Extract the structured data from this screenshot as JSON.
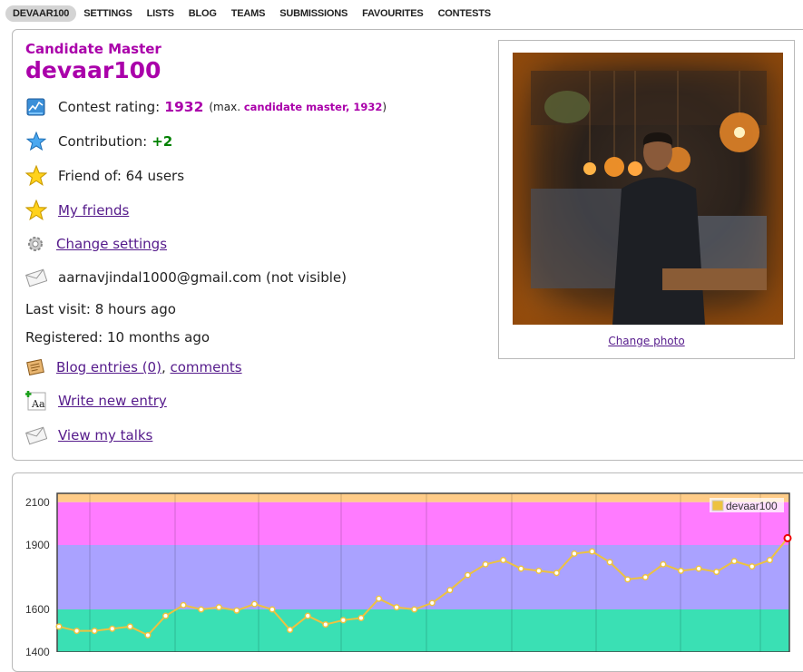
{
  "nav": {
    "items": [
      "DEVAAR100",
      "SETTINGS",
      "LISTS",
      "BLOG",
      "TEAMS",
      "SUBMISSIONS",
      "FAVOURITES",
      "CONTESTS"
    ],
    "active_index": 0
  },
  "profile": {
    "rank": "Candidate Master",
    "handle": "devaar100",
    "rating_label": "Contest rating:",
    "rating": "1932",
    "max_prefix": "(max.",
    "max_rank": "candidate master, 1932",
    "max_suffix": ")",
    "contribution_label": "Contribution:",
    "contribution": "+2",
    "friend_of": "Friend of: 64 users",
    "my_friends": "My friends",
    "change_settings": "Change settings",
    "email": "aarnavjindal1000@gmail.com (not visible)",
    "last_visit": "Last visit: 8 hours ago",
    "registered": "Registered: 10 months ago",
    "blog_entries": "Blog entries (0)",
    "comma": ",",
    "comments": "comments",
    "write_entry": "Write new entry",
    "view_talks": "View my talks",
    "change_photo": "Change photo"
  },
  "colors": {
    "rank": "#aa00aa",
    "contribution": "#008000",
    "link": "#551a8b",
    "line": "#edc240"
  },
  "chart_data": {
    "type": "line",
    "y_ticks": [
      "2100",
      "1900",
      "1600",
      "1400"
    ],
    "ylim": [
      1400,
      2130
    ],
    "legend": "top-right",
    "bands": [
      {
        "from": 1400,
        "to": 1600,
        "color": "#3ae0b4"
      },
      {
        "from": 1600,
        "to": 1900,
        "color": "#aaa2ff"
      },
      {
        "from": 1900,
        "to": 2100,
        "color": "#ff7bff"
      },
      {
        "from": 2100,
        "to": 2200,
        "color": "#ffcc88"
      }
    ],
    "series": [
      {
        "name": "devaar100",
        "values": [
          1520,
          1500,
          1500,
          1510,
          1520,
          1480,
          1570,
          1620,
          1600,
          1610,
          1595,
          1625,
          1600,
          1505,
          1570,
          1530,
          1550,
          1560,
          1650,
          1610,
          1600,
          1630,
          1690,
          1760,
          1810,
          1830,
          1790,
          1780,
          1770,
          1860,
          1870,
          1820,
          1740,
          1750,
          1810,
          1780,
          1790,
          1775,
          1825,
          1800,
          1830,
          1932
        ]
      }
    ]
  }
}
